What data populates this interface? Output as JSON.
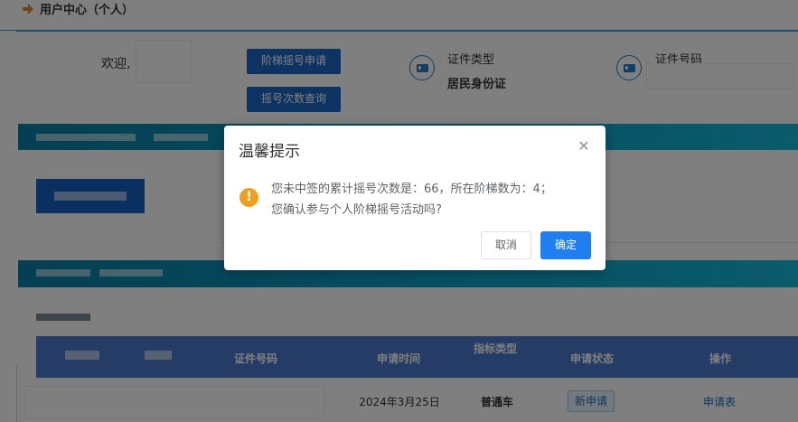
{
  "header": {
    "title": "用户中心（个人）"
  },
  "user": {
    "welcome": "欢迎,",
    "id_type_label": "证件类型",
    "id_type_value": "居民身份证",
    "id_number_label": "证件号码"
  },
  "buttons": {
    "ladder_apply": "阶梯摇号申请",
    "count_query": "摇号次数查询"
  },
  "table": {
    "headers": [
      "证件号码",
      "申请时间",
      "指标类型",
      "申请状态",
      "操作"
    ],
    "row": {
      "apply_time": "2024年3月25日",
      "indicator_type": "普通车",
      "status": "新申请",
      "action": "申请表"
    }
  },
  "dialog": {
    "title": "温馨提示",
    "message_line1": "您未中签的累计摇号次数是：66，所在阶梯数为：4；",
    "message_line2": "您确认参与个人阶梯摇号活动吗?",
    "cancel": "取消",
    "confirm": "确定"
  },
  "colors": {
    "accent": "#1f7ff1",
    "band": "#0ca3c8",
    "table_header": "#4a7acd",
    "warning": "#f0a020"
  },
  "icons": [
    "arrow-right-icon",
    "id-card-icon",
    "warning-icon",
    "close-icon"
  ]
}
